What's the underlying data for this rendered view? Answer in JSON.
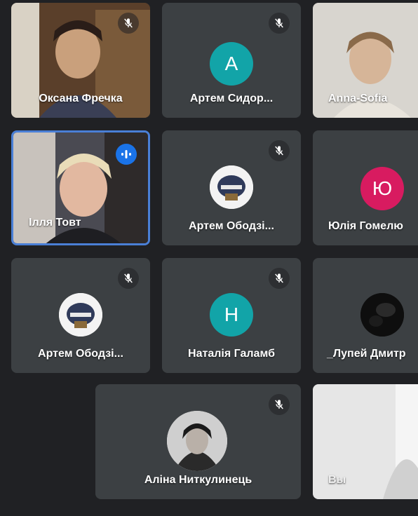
{
  "participants": [
    {
      "name": "Оксана Фречка",
      "type": "video",
      "muted": true
    },
    {
      "name": "Артем Сидор...",
      "type": "initial",
      "initial": "А",
      "color": "#12a4a8",
      "muted": true
    },
    {
      "name": "Anna-Sofia",
      "type": "video",
      "muted": false
    },
    {
      "name": "Ілля Товт",
      "type": "video",
      "speaking": true
    },
    {
      "name": "Артем Ободзі...",
      "type": "photo",
      "muted": true
    },
    {
      "name": "Юлія Гомелю",
      "type": "initial",
      "initial": "Ю",
      "color": "#d81b60",
      "muted": false
    },
    {
      "name": "Артем Ободзі...",
      "type": "photo",
      "muted": true
    },
    {
      "name": "Наталія Галамб",
      "type": "initial",
      "initial": "Н",
      "color": "#12a4a8",
      "muted": true
    },
    {
      "name": "_Лупей Дмитр",
      "type": "photo",
      "muted": false
    },
    {
      "name": "Аліна Ниткулинець",
      "type": "photo",
      "muted": true
    },
    {
      "name": "Вы",
      "type": "video",
      "muted": false
    }
  ],
  "colors": {
    "background": "#202124",
    "tile": "#3c4043",
    "active_border": "#4a7fd6",
    "speaking": "#1a73e8"
  }
}
